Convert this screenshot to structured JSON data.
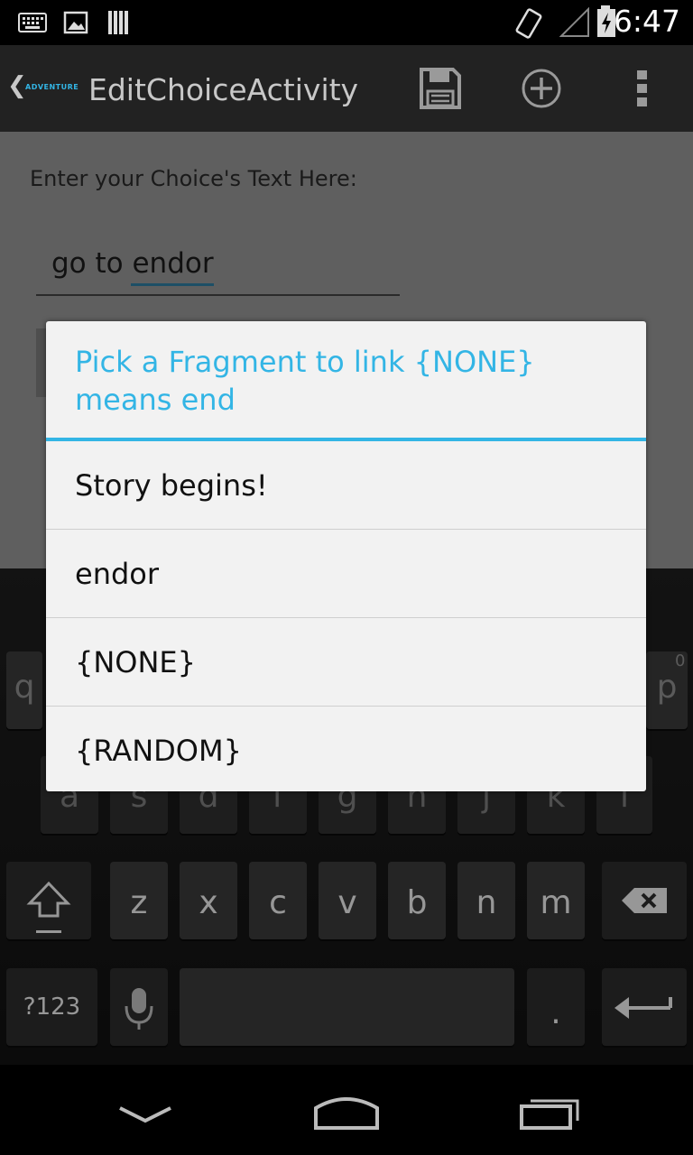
{
  "status_bar": {
    "time": "6:47"
  },
  "action_bar": {
    "logo_text": "ADVENTURE",
    "title": "EditChoiceActivity"
  },
  "content": {
    "prompt": "Enter your Choice's Text Here:",
    "input_value": "go to endor"
  },
  "dialog": {
    "title": "Pick a Fragment to link {NONE} means end",
    "options": [
      {
        "label": "Story begins!"
      },
      {
        "label": "endor"
      },
      {
        "label": "{NONE}"
      },
      {
        "label": "{RANDOM}"
      }
    ]
  },
  "keyboard": {
    "row1_visible": [
      "q",
      "p"
    ],
    "row1_hint": "0",
    "row2": [
      "a",
      "s",
      "d",
      "f",
      "g",
      "h",
      "j",
      "k",
      "l"
    ],
    "row3": [
      "z",
      "x",
      "c",
      "v",
      "b",
      "n",
      "m"
    ],
    "symbols_label": "?123",
    "period_label": "."
  },
  "colors": {
    "accent": "#33b5e5",
    "action_bar": "#222222",
    "dialog_bg": "#f2f2f2"
  }
}
